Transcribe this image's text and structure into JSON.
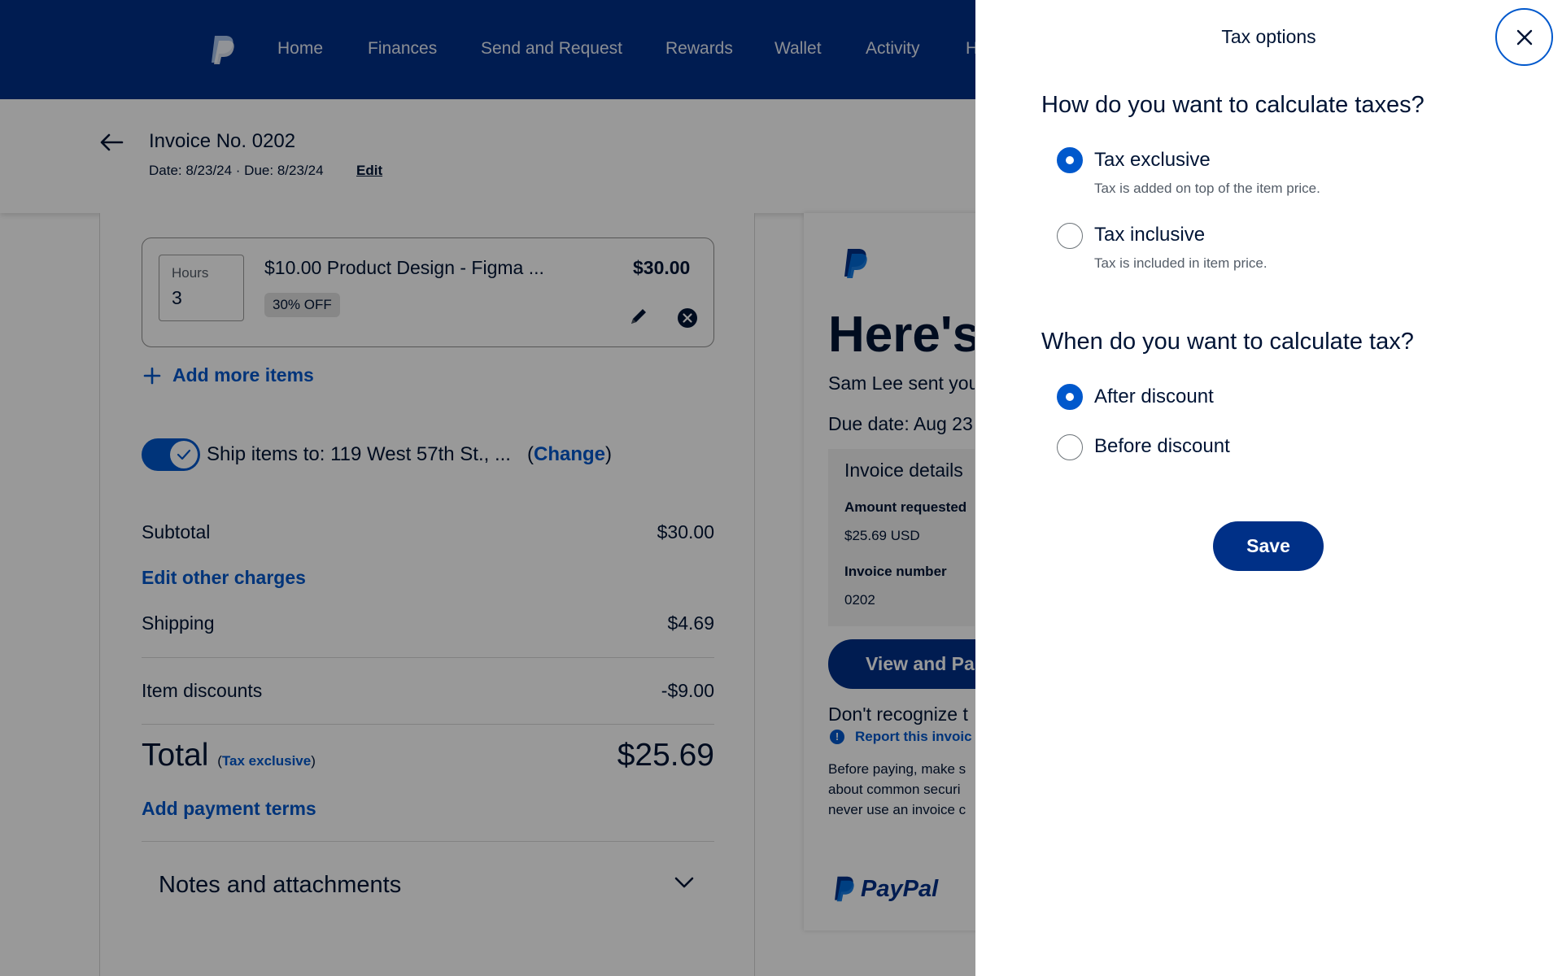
{
  "nav": {
    "items": [
      "Home",
      "Finances",
      "Send and Request",
      "Rewards",
      "Wallet",
      "Activity",
      "H"
    ]
  },
  "invoice_header": {
    "title": "Invoice No. 0202",
    "dates": "Date: 8/23/24 · Due: 8/23/24",
    "edit_label": "Edit"
  },
  "item": {
    "hours_label": "Hours",
    "hours_value": "3",
    "description": "$10.00 Product Design - Figma ...",
    "price": "$30.00",
    "discount_badge": "30% OFF"
  },
  "add_more_items": "Add more items",
  "shipping_address": {
    "label": "Ship items to:",
    "address": "119 West 57th St., ...",
    "change_label": "Change",
    "enabled": true
  },
  "totals": {
    "subtotal_label": "Subtotal",
    "subtotal_value": "$30.00",
    "edit_other_charges": "Edit other charges",
    "shipping_label": "Shipping",
    "shipping_value": "$4.69",
    "item_discounts_label": "Item discounts",
    "item_discounts_value": "-$9.00",
    "total_label": "Total",
    "tax_mode": "Tax exclusive",
    "total_value": "$25.69",
    "add_payment_terms": "Add payment terms",
    "notes_label": "Notes and attachments"
  },
  "preview": {
    "heading": "Here's y",
    "sender_line": "Sam Lee sent you",
    "due_line": "Due date: Aug 23",
    "details_title": "Invoice details",
    "amount_label": "Amount requested",
    "amount_value": "$25.69 USD",
    "number_label": "Invoice number",
    "number_value": "0202",
    "view_pay_button": "View and Pa",
    "dont_recognize": "Don't recognize t",
    "report_link": "Report this invoic",
    "warning_lines": [
      "Before paying, make s",
      "about common securi",
      "never use an invoice c"
    ],
    "brand": "PayPal"
  },
  "tax_sheet": {
    "title": "Tax options",
    "q1": "How do you want to calculate taxes?",
    "q1_options": [
      {
        "label": "Tax exclusive",
        "help": "Tax is added on top of the item price.",
        "selected": true
      },
      {
        "label": "Tax inclusive",
        "help": "Tax is included in item price.",
        "selected": false
      }
    ],
    "q2": "When do you want to calculate tax?",
    "q2_options": [
      {
        "label": "After discount",
        "selected": true
      },
      {
        "label": "Before discount",
        "selected": false
      }
    ],
    "save_label": "Save"
  },
  "colors": {
    "nav_bg": "#003087",
    "accent_blue": "#0058cc",
    "text_dark": "#001435",
    "overlay": "rgba(0,0,0,0.40)"
  }
}
